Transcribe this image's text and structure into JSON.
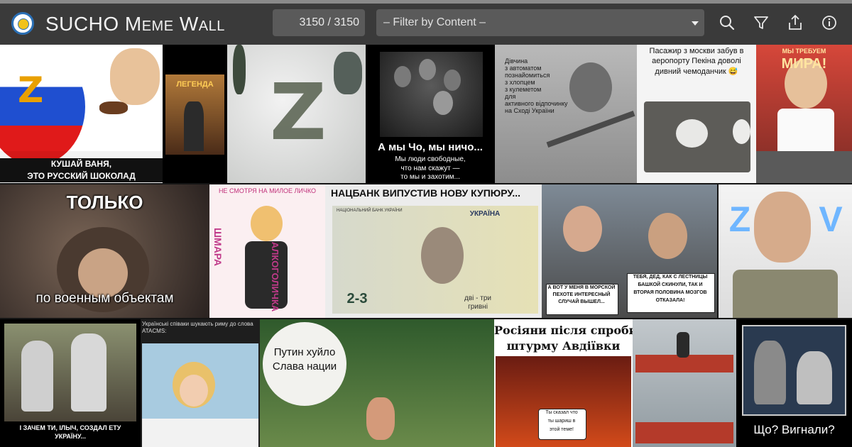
{
  "app": {
    "title": "SUCHO Meme Wall",
    "counter": "3150 / 3150",
    "filter_placeholder": "– Filter by Content –"
  },
  "toolbar": {
    "icons": [
      "search-icon",
      "filter-icon",
      "share-icon",
      "info-icon"
    ]
  },
  "memes": {
    "m1": {
      "cap1": "КУШАЙ ВАНЯ,",
      "cap2": "ЭТО РУССКИЙ ШОКОЛАД"
    },
    "m2": {
      "cap": "ЛЕГЕНДА"
    },
    "m4": {
      "cap1": "А мы Чо, мы ничо...",
      "cap2": "Мы люди свободные,",
      "cap3": "что нам скажут —",
      "cap4": "то мы и захотим..."
    },
    "m5": {
      "l1": "Дівчина",
      "l2": "з автоматом",
      "l3": "познайомиться",
      "l4": "з хлопцем",
      "l5": "з кулеметом",
      "l6": "для",
      "l7": "активного відпочинку",
      "l8": "на Сході України"
    },
    "m6": {
      "l1": "Пасажир з москви забув в",
      "l2": "аеропорту Пекіна доволі",
      "l3": "дивний чемоданчик 😅"
    },
    "m7": {
      "l1": "МЫ ТРЕБУЕМ",
      "l2": "МИРА!"
    },
    "m8": {
      "cap1": "ТОЛЬКО",
      "cap2": "по военным объектам"
    },
    "m9": {
      "top": "НЕ СМОТРЯ НА МИЛОЕ ЛИЧКО",
      "left": "ШМАРА",
      "right": "АЛКОГОЛИЧКА"
    },
    "m10": {
      "title": "НАЦБАНК ВИПУСТИВ НОВУ КУПЮРУ...",
      "bank": "НАЦІОНАЛЬНИЙ БАНК УКРАЇНИ",
      "country": "УКРАЇНА",
      "denom": "2-3",
      "words1": "дві - три",
      "words2": "гривні"
    },
    "m11": {
      "b1a": "А ВОТ У МЕНЯ В МОРСКОЙ",
      "b1b": "ПЕХОТЕ ИНТЕРЕСНЫЙ",
      "b1c": "СЛУЧАЙ ВЫШЕЛ...",
      "b2a": "ТЕБЯ, ДЕД, КАК С ЛЕСТНИЦЫ",
      "b2b": "БАШКОЙ СКИНУЛИ, ТАК И",
      "b2c": "ВТОРАЯ ПОЛОВИНА МОЗГОВ",
      "b2d": "ОТКАЗАЛА!"
    },
    "m12": {
      "l": "Z",
      "r": "V"
    },
    "m13": {
      "cap1": "І ЗАЧЕМ ТИ, ІЛЬІЧ, СОЗДАЛ ЕТУ",
      "cap2": "УКРАЇНУ..."
    },
    "m14": {
      "l1": "Українські співаки шукають риму до слова",
      "l2": "ATACMS:"
    },
    "m15": {
      "l1": "Путин хуйло",
      "l2": "Слава нации"
    },
    "m16": {
      "l1": "Росіяни після спроби",
      "l2": "штурму Авдіївки",
      "bubble1": "Ты сказал что",
      "bubble2": "ты шариш в",
      "bubble3": "этой теме!"
    },
    "m18": {
      "cap": "Що? Вигнали?"
    }
  }
}
